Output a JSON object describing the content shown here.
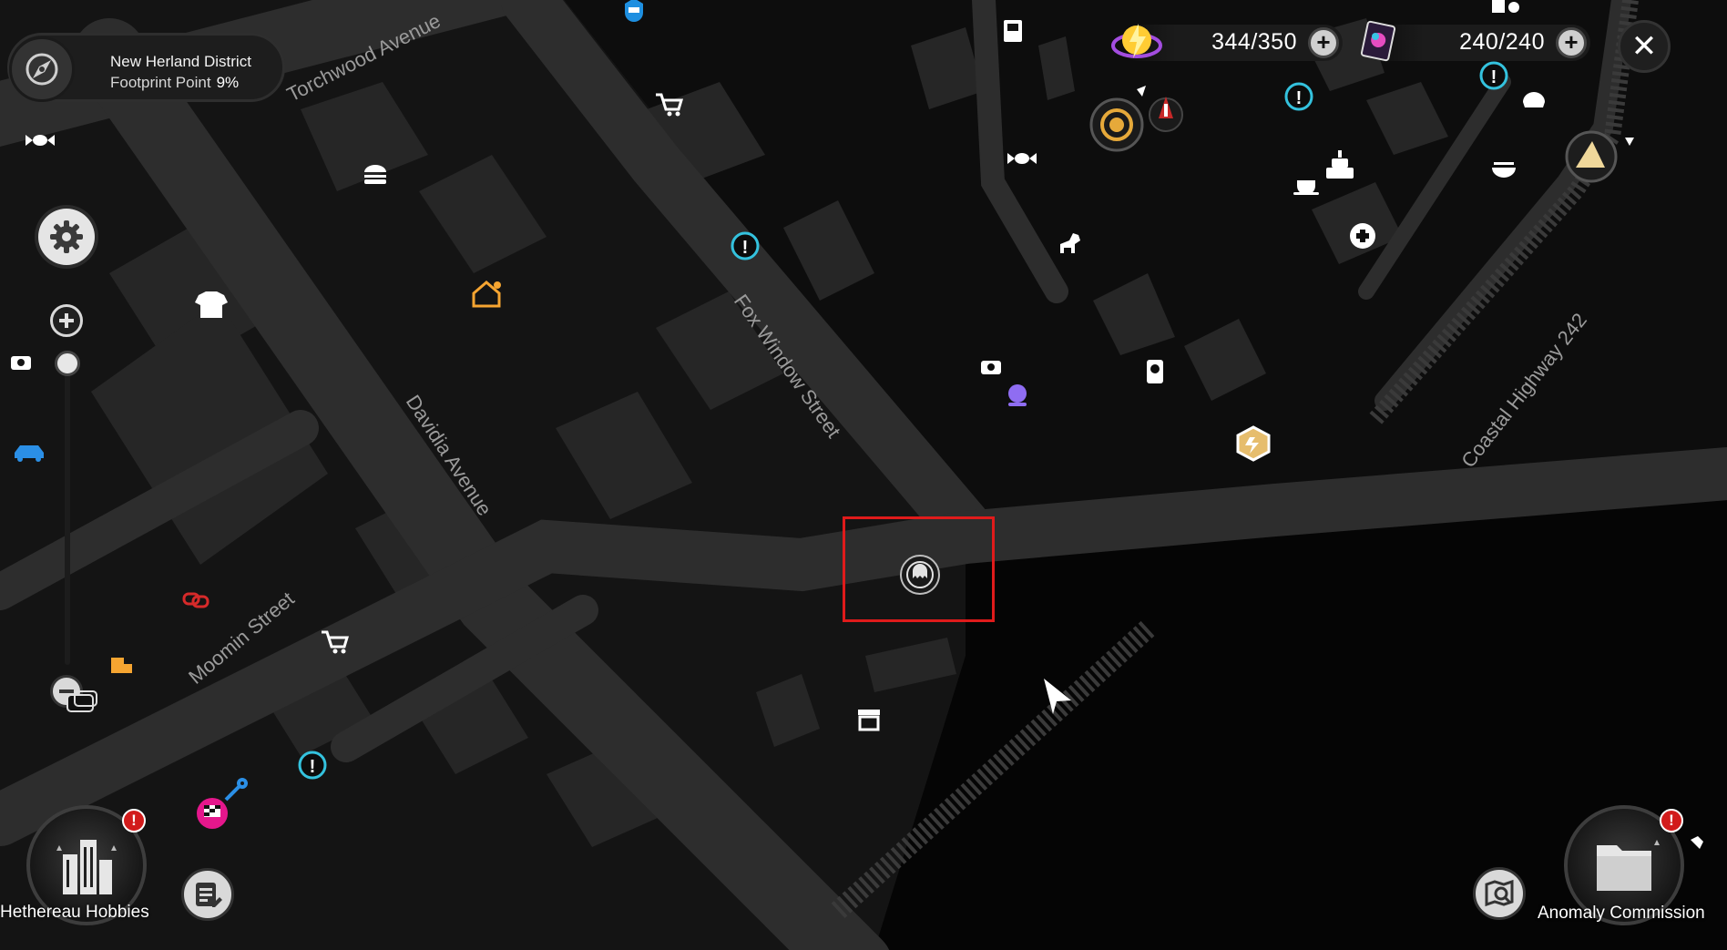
{
  "location": {
    "district": "New Herland District",
    "footprint_label": "Footprint Point",
    "footprint_percent": "9%"
  },
  "currencies": [
    {
      "name": "battery-charge",
      "value": "344/350",
      "icon": "battery-orb-icon"
    },
    {
      "name": "card-stamina",
      "value": "240/240",
      "icon": "tarot-card-icon"
    }
  ],
  "close_label": "✕",
  "streets": {
    "torchwood": "Torchwood Avenue",
    "fox_window": "Fox Window Street",
    "davidia": "Davidia Avenue",
    "moomin": "Moomin Street",
    "coastal": "Coastal Highway 242"
  },
  "bottom": {
    "left_button_label": "Hethereau Hobbies",
    "right_button_label": "Anomaly Commission",
    "alert_mark": "!"
  },
  "zoom": {
    "level": 0.0
  },
  "colors": {
    "quest_marker": "#34c2de",
    "selection_box": "#e01b1b",
    "home_marker": "#f6a531",
    "energy_marker": "#e6bd6d",
    "vehicle_marker": "#2b8fe6",
    "race_marker": "#e5178c",
    "crystal_marker": "#8f6df2"
  }
}
